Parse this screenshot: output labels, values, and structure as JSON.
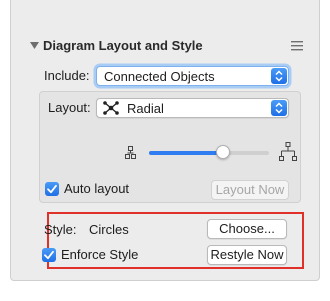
{
  "header": {
    "title": "Diagram Layout and Style",
    "disclosure_icon": "triangle-down-icon",
    "menu_icon": "hamburger-menu-icon"
  },
  "include": {
    "label": "Include:",
    "value": "Connected Objects"
  },
  "layout": {
    "label": "Layout:",
    "value": "Radial",
    "icon": "radial-layout-icon"
  },
  "spacing_slider": {
    "min_icon": "compact-tree-icon",
    "max_icon": "expanded-tree-icon",
    "level": 0.62
  },
  "auto_layout": {
    "label": "Auto layout",
    "checked": true,
    "button_label": "Layout Now"
  },
  "style": {
    "label": "Style:",
    "value": "Circles",
    "choose_label": "Choose...",
    "enforce_label": "Enforce Style",
    "enforce_checked": true,
    "restyle_label": "Restyle Now"
  },
  "colors": {
    "accent": "#1f6fe6",
    "highlight_box": "#e0302a"
  }
}
